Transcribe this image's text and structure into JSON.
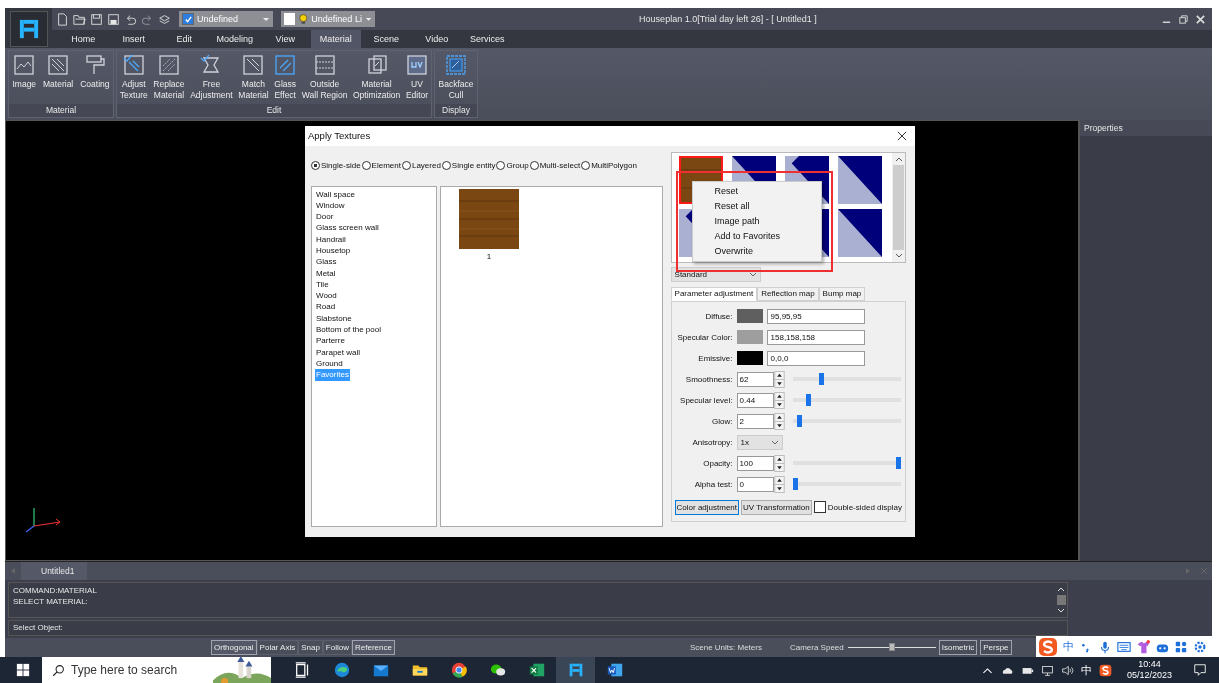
{
  "window": {
    "title": "Houseplan 1.0[Trial day left 26] -  [ Untitled1 ]"
  },
  "quick_combos": [
    {
      "kind": "layer",
      "value": "Undefined",
      "checked": true
    },
    {
      "kind": "line",
      "value": "Undefined Li"
    }
  ],
  "ribbon_tabs": [
    {
      "label": "Home",
      "selected": false
    },
    {
      "label": "Insert",
      "selected": false
    },
    {
      "label": "Edit",
      "selected": false
    },
    {
      "label": "Modeling",
      "selected": false
    },
    {
      "label": "View",
      "selected": false
    },
    {
      "label": "Material",
      "selected": true
    },
    {
      "label": "Scene",
      "selected": false
    },
    {
      "label": "Video",
      "selected": false
    },
    {
      "label": "Services",
      "selected": false
    }
  ],
  "ribbon_groups": [
    {
      "label": "Material",
      "buttons": [
        {
          "lines": [
            "Image"
          ]
        },
        {
          "lines": [
            "Material"
          ]
        },
        {
          "lines": [
            "Coating"
          ]
        }
      ]
    },
    {
      "label": "Edit",
      "buttons": [
        {
          "lines": [
            "Adjust",
            "Texture"
          ]
        },
        {
          "lines": [
            "Replace",
            "Material"
          ]
        },
        {
          "lines": [
            "Free",
            "Adjustment"
          ]
        },
        {
          "lines": [
            "Match",
            "Material"
          ]
        },
        {
          "lines": [
            "Glass",
            "Effect"
          ]
        },
        {
          "lines": [
            "Outside",
            "Wall Region"
          ]
        },
        {
          "lines": [
            "Material",
            "Optimization"
          ]
        },
        {
          "lines": [
            "UV",
            "Editor"
          ]
        }
      ]
    },
    {
      "label": "Display",
      "buttons": [
        {
          "lines": [
            "Backface",
            "Cull"
          ]
        }
      ]
    }
  ],
  "dialog": {
    "title": "Apply Textures",
    "modes": [
      {
        "label": "Single-side",
        "selected": true
      },
      {
        "label": "Element",
        "selected": false
      },
      {
        "label": "Layered",
        "selected": false
      },
      {
        "label": "Single entity",
        "selected": false
      },
      {
        "label": "Group",
        "selected": false
      },
      {
        "label": "Multi-select",
        "selected": false
      },
      {
        "label": "MultiPolygon",
        "selected": false
      }
    ],
    "categories": [
      {
        "label": "Wall space",
        "selected": false
      },
      {
        "label": "Window",
        "selected": false
      },
      {
        "label": "Door",
        "selected": false
      },
      {
        "label": "Glass screen wall",
        "selected": false
      },
      {
        "label": "Handrail",
        "selected": false
      },
      {
        "label": "Housetop",
        "selected": false
      },
      {
        "label": "Glass",
        "selected": false
      },
      {
        "label": "Metal",
        "selected": false
      },
      {
        "label": "Tile",
        "selected": false
      },
      {
        "label": "Wood",
        "selected": false
      },
      {
        "label": "Road",
        "selected": false
      },
      {
        "label": "Slabstone",
        "selected": false
      },
      {
        "label": "Bottom of the pool",
        "selected": false
      },
      {
        "label": "Parterre",
        "selected": false
      },
      {
        "label": "Parapet wall",
        "selected": false
      },
      {
        "label": "Ground",
        "selected": false
      },
      {
        "label": "Favorites",
        "selected": true
      }
    ],
    "textures": [
      {
        "label": "1"
      }
    ],
    "thumbnails": [
      {
        "kind": "wood",
        "selected": true
      },
      {
        "kind": "diag_a",
        "selected": false
      },
      {
        "kind": "diag_b",
        "selected": false
      },
      {
        "kind": "diag_a",
        "selected": false
      },
      {
        "kind": "diag_b",
        "selected": false
      },
      {
        "kind": "diag_b",
        "selected": false
      },
      {
        "kind": "diag_a",
        "selected": false
      }
    ],
    "context_menu": [
      "Reset",
      "Reset all",
      "Image path",
      "Add to Favorites",
      "Overwrite"
    ],
    "texture_set": "Standard",
    "param_tabs": [
      {
        "label": "Parameter adjustment",
        "selected": true
      },
      {
        "label": "Reflection map",
        "selected": false
      },
      {
        "label": "Bump map",
        "selected": false
      }
    ],
    "colors": [
      {
        "label": "Diffuse:",
        "color": "#5f5f5f",
        "value": "95,95,95"
      },
      {
        "label": "Specular Color:",
        "color": "#9e9e9e",
        "value": "158,158,158"
      },
      {
        "label": "Emissive:",
        "color": "#000000",
        "value": "0,0,0"
      }
    ],
    "params": [
      {
        "kind": "spin",
        "label": "Smoothness:",
        "value": "62",
        "level": 0.26
      },
      {
        "kind": "spin",
        "label": "Specular level:",
        "value": "0.44",
        "level": 0.13
      },
      {
        "kind": "spin",
        "label": "Glow:",
        "value": "2",
        "level": 0.04
      },
      {
        "kind": "select",
        "label": "Anisotropy:",
        "value": "1x"
      },
      {
        "kind": "spin",
        "label": "Opacity:",
        "value": "100",
        "level": 1
      },
      {
        "kind": "spin",
        "label": "Alpha test:",
        "value": "0",
        "level": 0
      }
    ],
    "bottom_buttons": [
      {
        "label": "Color adjustment",
        "selected": true
      },
      {
        "label": "UV Transformation",
        "selected": false
      }
    ],
    "double_sided": {
      "label": "Double-sided display",
      "checked": false
    }
  },
  "properties_panel": {
    "title": "Properties"
  },
  "document_tabs": [
    {
      "label": "Untitled1"
    }
  ],
  "command_window": {
    "lines": [
      "COMMAND:MATERIAL",
      "SELECT MATERIAL:"
    ],
    "prompt": "Select Object:"
  },
  "status_bar": {
    "toggles": [
      {
        "label": "Orthogonal",
        "on": true
      },
      {
        "label": "Polar Axis",
        "on": false
      },
      {
        "label": "Snap",
        "on": false
      },
      {
        "label": "Follow",
        "on": false
      },
      {
        "label": "Reference",
        "on": true
      }
    ],
    "scene_units": "Scene Units: Meters",
    "camera_speed": {
      "label": "Camera Speed",
      "level": 0.5
    },
    "view_modes": [
      {
        "label": "Isometric"
      },
      {
        "label": "Perspe"
      }
    ]
  },
  "ime_bar": {
    "mode": "中"
  },
  "taskbar": {
    "search_placeholder": "Type here to search",
    "tray_ime": "中",
    "time": "10:44",
    "date": "05/12/2023"
  }
}
